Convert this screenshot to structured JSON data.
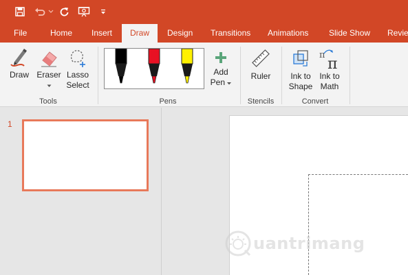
{
  "qat": {
    "icons": [
      "save-icon",
      "undo-icon",
      "redo-icon",
      "present-from-beginning-icon",
      "customize-qat-icon"
    ]
  },
  "tabs": [
    {
      "label": "File",
      "active": false
    },
    {
      "label": "Home",
      "active": false
    },
    {
      "label": "Insert",
      "active": false
    },
    {
      "label": "Draw",
      "active": true
    },
    {
      "label": "Design",
      "active": false
    },
    {
      "label": "Transitions",
      "active": false
    },
    {
      "label": "Animations",
      "active": false
    },
    {
      "label": "Slide Show",
      "active": false
    },
    {
      "label": "Review",
      "active": false
    }
  ],
  "ribbon": {
    "tools": {
      "group_label": "Tools",
      "draw_label": "Draw",
      "eraser_label": "Eraser",
      "lasso_label_1": "Lasso",
      "lasso_label_2": "Select"
    },
    "pens": {
      "group_label": "Pens",
      "pen_colors": [
        "#000000",
        "#e81123",
        "#fff100"
      ],
      "add_pen_label_1": "Add",
      "add_pen_label_2": "Pen"
    },
    "stencils": {
      "group_label": "Stencils",
      "ruler_label": "Ruler"
    },
    "convert": {
      "group_label": "Convert",
      "ink_to_shape_1": "Ink to",
      "ink_to_shape_2": "Shape",
      "ink_to_math_1": "Ink to",
      "ink_to_math_2": "Math"
    }
  },
  "slides": {
    "current_number": "1"
  },
  "colors": {
    "accent": "#d24726",
    "selected_thumb_border": "#e8795a"
  },
  "watermark": {
    "text": "uantrimang"
  }
}
